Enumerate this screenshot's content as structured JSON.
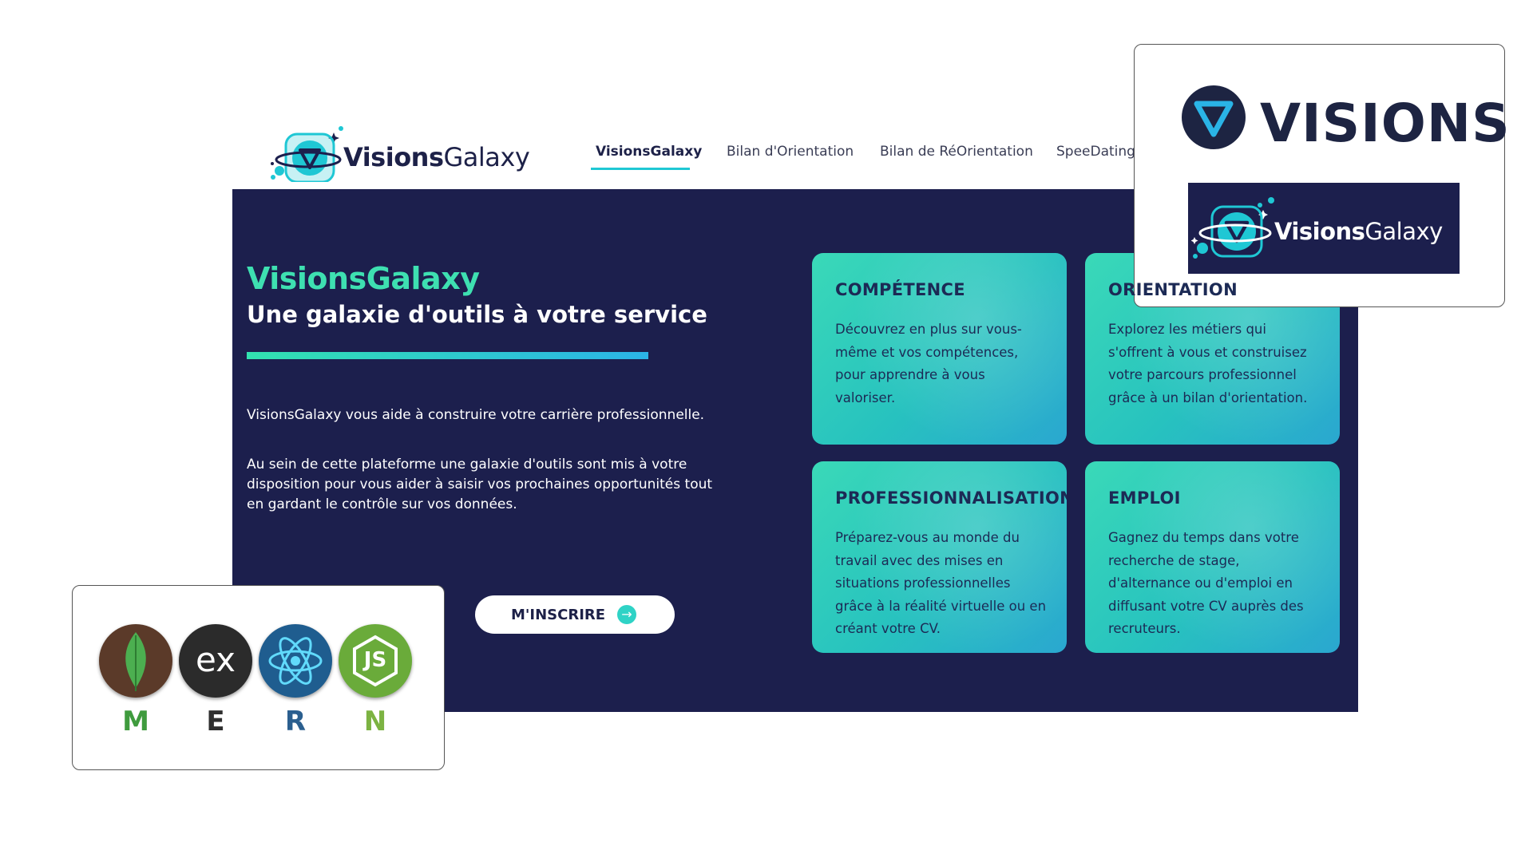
{
  "site": {
    "logo_text_bold": "Visions",
    "logo_text_light": "Galaxy"
  },
  "nav": {
    "items": [
      "VisionsGalaxy",
      "Bilan d'Orientation",
      "Bilan de RéOrientation",
      "SpeeDating"
    ],
    "active_index": 0
  },
  "hero": {
    "title": "VisionsGalaxy",
    "subtitle": "Une galaxie d'outils à votre service",
    "paragraph1": "VisionsGalaxy vous aide à construire votre carrière professionnelle.",
    "paragraph2": "Au sein de cette plateforme une galaxie d'outils sont mis à votre disposition pour vous aider à saisir vos prochaines opportunités tout en gardant le contrôle sur vos données.",
    "signup_label": "M'INSCRIRE",
    "signup_icon": "arrow-right-icon"
  },
  "cards": [
    {
      "title": "COMPÉTENCE",
      "text": "Découvrez en plus sur vous-même et vos compétences, pour apprendre à vous valoriser."
    },
    {
      "title": "ORIENTATION",
      "text": "Explorez les métiers qui s'offrent à vous et construisez votre parcours professionnel grâce à un bilan d'orientation."
    },
    {
      "title": "PROFESSIONNALISATION",
      "text": "Préparez-vous au monde du travail avec des mises en situations professionnelles grâce à la réalité virtuelle ou en créant votre CV."
    },
    {
      "title": "EMPLOI",
      "text": "Gagnez du temps dans votre recherche de stage, d'alternance ou d'emploi en diffusant votre CV auprès des recruteurs."
    }
  ],
  "visions_box": {
    "wordmark": "VISIONS",
    "banner_bold": "Visions",
    "banner_light": "Galaxy"
  },
  "mern": {
    "letters": [
      "M",
      "E",
      "R",
      "N"
    ],
    "icons": [
      "mongodb-leaf-icon",
      "express-ex-icon",
      "react-atom-icon",
      "nodejs-hex-icon"
    ],
    "letter_colors": [
      "#3f9b3e",
      "#2f2f2f",
      "#2b5f8f",
      "#7cb342"
    ],
    "express_text": "ex",
    "node_text": "JS"
  },
  "colors": {
    "navy": "#1c1f4d",
    "teal": "#3ee0b1",
    "cyan": "#27b7e0"
  }
}
